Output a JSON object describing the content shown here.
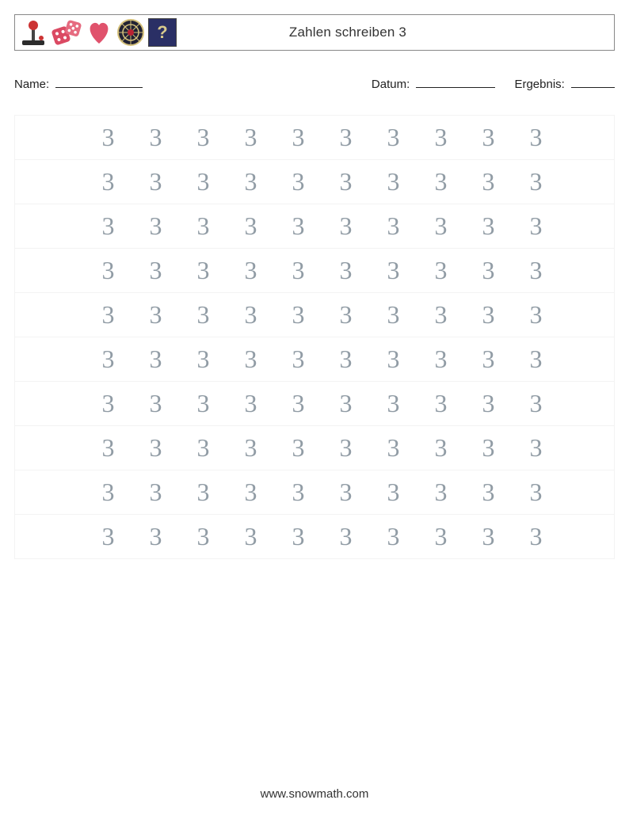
{
  "header": {
    "title": "Zahlen schreiben 3",
    "icons": [
      "joystick-icon",
      "dice-icon",
      "heart-icon",
      "dartboard-icon",
      "question-box-icon"
    ]
  },
  "meta": {
    "name_label": "Name:",
    "date_label": "Datum:",
    "result_label": "Ergebnis:"
  },
  "practice": {
    "digit": "3",
    "rows": 10,
    "cols": 10
  },
  "footer": {
    "url": "www.snowmath.com"
  }
}
